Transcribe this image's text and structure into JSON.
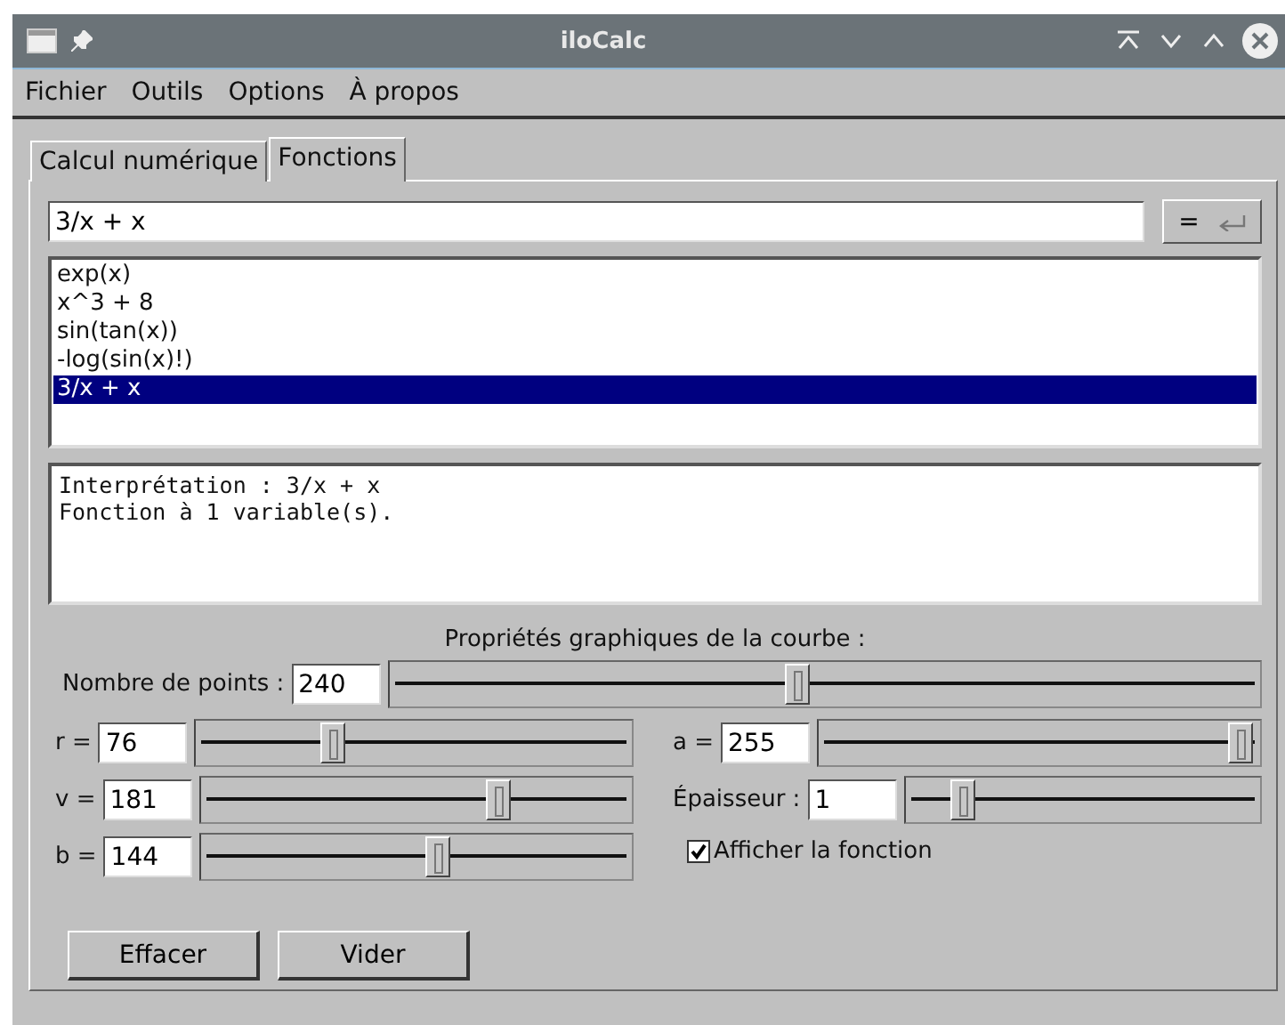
{
  "window": {
    "title": "iloCalc"
  },
  "menu": [
    "Fichier",
    "Outils",
    "Options",
    "À propos"
  ],
  "tabs": [
    {
      "label": "Calcul numérique",
      "selected": false
    },
    {
      "label": "Fonctions",
      "selected": true
    }
  ],
  "expression": {
    "value": "3/x + x",
    "button": "="
  },
  "functions": [
    {
      "label": "exp(x)",
      "selected": false
    },
    {
      "label": "x^3 + 8",
      "selected": false
    },
    {
      "label": "sin(tan(x))",
      "selected": false
    },
    {
      "label": "-log(sin(x)!)",
      "selected": false
    },
    {
      "label": "3/x + x",
      "selected": true
    }
  ],
  "output": [
    "Interprétation : 3/x + x",
    "Fonction à 1 variable(s)."
  ],
  "properties": {
    "title": "Propriétés graphiques de la courbe :",
    "points": {
      "label": "Nombre de points :",
      "value": "240",
      "level": 0.47
    },
    "left": [
      {
        "kind": "slider",
        "label": "r =",
        "value": "76",
        "level": 0.3
      },
      {
        "kind": "slider",
        "label": "v =",
        "value": "181",
        "level": 0.71
      },
      {
        "kind": "slider",
        "label": "b =",
        "value": "144",
        "level": 0.56
      }
    ],
    "right": [
      {
        "kind": "slider",
        "label": "a =",
        "value": "255",
        "level": 1
      },
      {
        "kind": "slider",
        "label": "Épaisseur :",
        "value": "1",
        "level": 0.13
      },
      {
        "kind": "checkbox",
        "label": "Afficher la fonction",
        "checked": true
      }
    ]
  },
  "buttons": [
    "Effacer",
    "Vider"
  ]
}
